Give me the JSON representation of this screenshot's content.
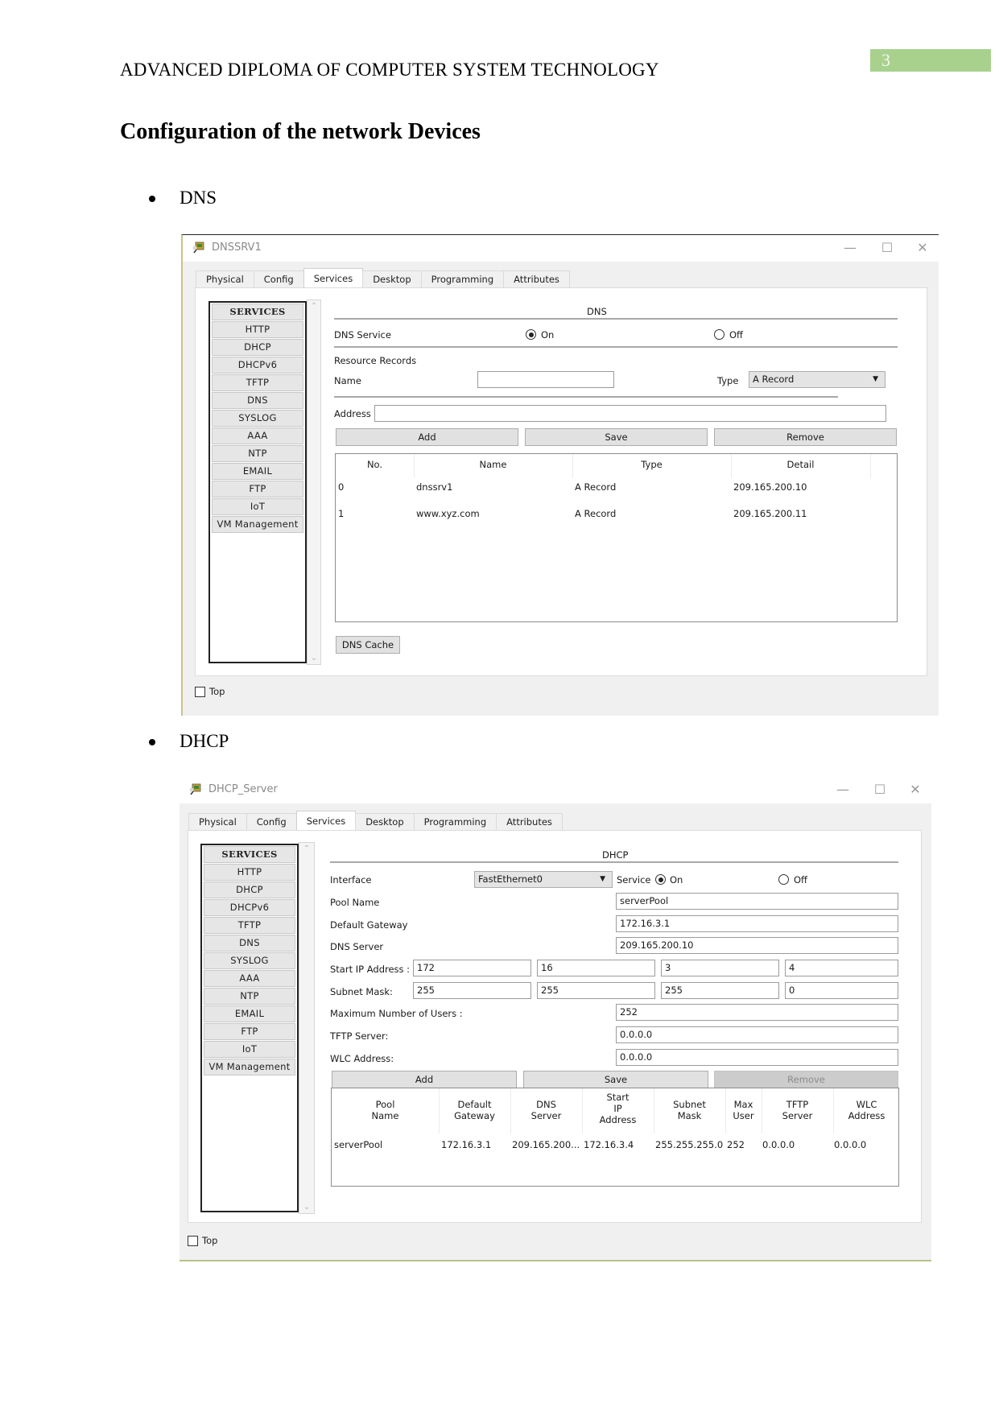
{
  "document": {
    "header_title": "ADVANCED DIPLOMA OF COMPUTER SYSTEM TECHNOLOGY",
    "page_number": "3",
    "page_number_color": "#a9d18e",
    "heading": "Configuration of the network Devices",
    "bullets": [
      "DNS",
      "DHCP"
    ]
  },
  "dns_window": {
    "title": "DNSSRV1",
    "window_controls": {
      "minimize": "—",
      "maximize": "☐",
      "close": "✕"
    },
    "tabs": [
      "Physical",
      "Config",
      "Services",
      "Desktop",
      "Programming",
      "Attributes"
    ],
    "active_tab": "Services",
    "services": [
      "SERVICES",
      "HTTP",
      "DHCP",
      "DHCPv6",
      "TFTP",
      "DNS",
      "SYSLOG",
      "AAA",
      "NTP",
      "EMAIL",
      "FTP",
      "IoT",
      "VM Management"
    ],
    "section_title": "DNS",
    "service_label": "DNS Service",
    "on_label": "On",
    "off_label": "Off",
    "service_state": "On",
    "resource_records_label": "Resource Records",
    "name_label": "Name",
    "name_value": "",
    "type_label": "Type",
    "type_value": "A Record",
    "address_label": "Address",
    "address_value": "",
    "buttons": {
      "add": "Add",
      "save": "Save",
      "remove": "Remove",
      "dns_cache": "DNS Cache"
    },
    "table": {
      "columns": [
        "No.",
        "Name",
        "Type",
        "Detail"
      ],
      "rows": [
        [
          "0",
          "dnssrv1",
          "A Record",
          "209.165.200.10"
        ],
        [
          "1",
          "www.xyz.com",
          "A Record",
          "209.165.200.11"
        ]
      ]
    },
    "top_checkbox_label": "Top",
    "top_checked": false
  },
  "dhcp_window": {
    "title": "DHCP_Server",
    "window_controls": {
      "minimize": "—",
      "maximize": "☐",
      "close": "✕"
    },
    "tabs": [
      "Physical",
      "Config",
      "Services",
      "Desktop",
      "Programming",
      "Attributes"
    ],
    "active_tab": "Services",
    "services": [
      "SERVICES",
      "HTTP",
      "DHCP",
      "DHCPv6",
      "TFTP",
      "DNS",
      "SYSLOG",
      "AAA",
      "NTP",
      "EMAIL",
      "FTP",
      "IoT",
      "VM Management"
    ],
    "section_title": "DHCP",
    "interface_label": "Interface",
    "interface_value": "FastEthernet0",
    "service_label": "Service",
    "on_label": "On",
    "off_label": "Off",
    "service_state": "On",
    "pool_name_label": "Pool Name",
    "pool_name_value": "serverPool",
    "default_gateway_label": "Default Gateway",
    "default_gateway_value": "172.16.3.1",
    "dns_server_label": "DNS Server",
    "dns_server_value": "209.165.200.10",
    "start_ip_label": "Start IP Address :",
    "start_ip_octets": [
      "172",
      "16",
      "3",
      "4"
    ],
    "subnet_mask_label": "Subnet Mask:",
    "subnet_mask_octets": [
      "255",
      "255",
      "255",
      "0"
    ],
    "max_users_label": "Maximum Number of Users :",
    "max_users_value": "252",
    "tftp_label": "TFTP Server:",
    "tftp_value": "0.0.0.0",
    "wlc_label": "WLC Address:",
    "wlc_value": "0.0.0.0",
    "buttons": {
      "add": "Add",
      "save": "Save",
      "remove": "Remove"
    },
    "table": {
      "columns": [
        [
          "Pool",
          "Name"
        ],
        [
          "Default",
          "Gateway"
        ],
        [
          "DNS",
          "Server"
        ],
        [
          "Start",
          "IP",
          "Address"
        ],
        [
          "Subnet",
          "Mask"
        ],
        [
          "Max",
          "User"
        ],
        [
          "TFTP",
          "Server"
        ],
        [
          "WLC",
          "Address"
        ]
      ],
      "rows": [
        [
          "serverPool",
          "172.16.3.1",
          "209.165.200...",
          "172.16.3.4",
          "255.255.255.0",
          "252",
          "0.0.0.0",
          "0.0.0.0"
        ]
      ]
    },
    "top_checkbox_label": "Top",
    "top_checked": false
  }
}
